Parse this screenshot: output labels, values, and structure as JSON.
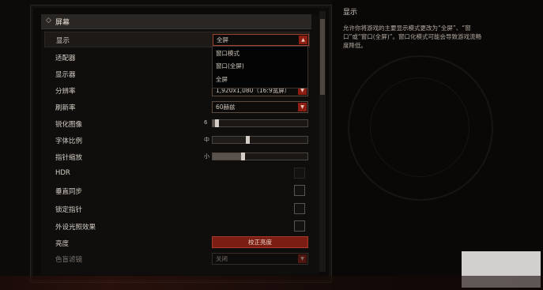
{
  "section": {
    "title": "屏幕"
  },
  "settings": {
    "display": {
      "label": "显示",
      "value": "全屏"
    },
    "adapter": {
      "label": "适配器"
    },
    "monitor": {
      "label": "显示器"
    },
    "resolution": {
      "label": "分辨率",
      "value": "1,920x1,080（16:9宽屏）"
    },
    "refresh": {
      "label": "刷新率",
      "value": "60赫兹"
    },
    "sharpen": {
      "label": "锐化图像",
      "value": "6"
    },
    "font_scale": {
      "label": "字体比例",
      "value": "中"
    },
    "cursor_scale": {
      "label": "指针缩放",
      "value": "小"
    },
    "hdr": {
      "label": "HDR"
    },
    "vsync": {
      "label": "垂直同步"
    },
    "lock_cursor": {
      "label": "锁定指针"
    },
    "peripheral": {
      "label": "外设光照效果"
    },
    "brightness": {
      "label": "亮度",
      "button": "校正亮度"
    },
    "color_filter": {
      "label": "色盲滤镜",
      "value": "关闭"
    }
  },
  "dropdown_menu": {
    "items": [
      "窗口模式",
      "窗口(全屏)",
      "全屏"
    ]
  },
  "info": {
    "title": "显示",
    "description": "允许你将游戏的主要显示模式更改为“全屏”、“窗口”或“窗口(全屏)”。窗口化模式可能会导致游戏流畅度降低。"
  }
}
